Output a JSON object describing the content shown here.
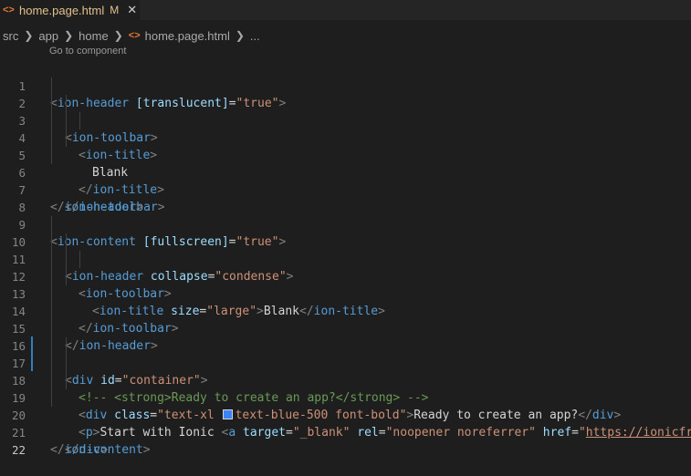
{
  "tab": {
    "icon": "<>",
    "title": "home.page.html",
    "modified": "M",
    "close": "✕"
  },
  "breadcrumb": [
    "src",
    "app",
    "home",
    "home.page.html",
    "..."
  ],
  "codelens": "Go to component",
  "swatch_color": "#3b82f6",
  "line_numbers": [
    "1",
    "2",
    "3",
    "4",
    "5",
    "6",
    "7",
    "8",
    "9",
    "10",
    "11",
    "12",
    "13",
    "14",
    "15",
    "16",
    "17",
    "18",
    "19",
    "20",
    "21",
    "22"
  ],
  "code": {
    "l1": [
      "<",
      "ion-header",
      " [translucent]",
      "=",
      "\"true\"",
      ">"
    ],
    "l2": [
      "<",
      "ion-toolbar",
      ">"
    ],
    "l3": [
      "<",
      "ion-title",
      ">"
    ],
    "l4": [
      "Blank"
    ],
    "l5": [
      "</",
      "ion-title",
      ">"
    ],
    "l6": [
      "</",
      "ion-toolbar",
      ">"
    ],
    "l7": [
      "</",
      "ion-header",
      ">"
    ],
    "l9": [
      "<",
      "ion-content",
      " [fullscreen]",
      "=",
      "\"true\"",
      ">"
    ],
    "l10": [
      "<",
      "ion-header",
      " collapse",
      "=",
      "\"condense\"",
      ">"
    ],
    "l11": [
      "<",
      "ion-toolbar",
      ">"
    ],
    "l12": [
      "<",
      "ion-title",
      " size",
      "=",
      "\"large\"",
      ">",
      "Blank",
      "</",
      "ion-title",
      ">"
    ],
    "l13": [
      "</",
      "ion-toolbar",
      ">"
    ],
    "l14": [
      "</",
      "ion-header",
      ">"
    ],
    "l16": [
      "<",
      "div",
      " id",
      "=",
      "\"container\"",
      ">"
    ],
    "l17": [
      "<!-- <strong>Ready to create an app?</strong> -->"
    ],
    "l18": [
      "<",
      "div",
      " class",
      "=",
      "\"text-xl ",
      "text-blue-500 font-bold\"",
      ">",
      "Ready to create an app?",
      "</",
      "div",
      ">"
    ],
    "l19": [
      "<",
      "p",
      ">",
      "Start with Ionic ",
      "<",
      "a",
      " target",
      "=",
      "\"_blank\"",
      " rel",
      "=",
      "\"noopener noreferrer\"",
      " href",
      "=",
      "\"",
      "https://ionicfram"
    ],
    "l20": [
      "</",
      "div",
      ">"
    ],
    "l21": [
      "</",
      "ion-content",
      ">"
    ]
  }
}
